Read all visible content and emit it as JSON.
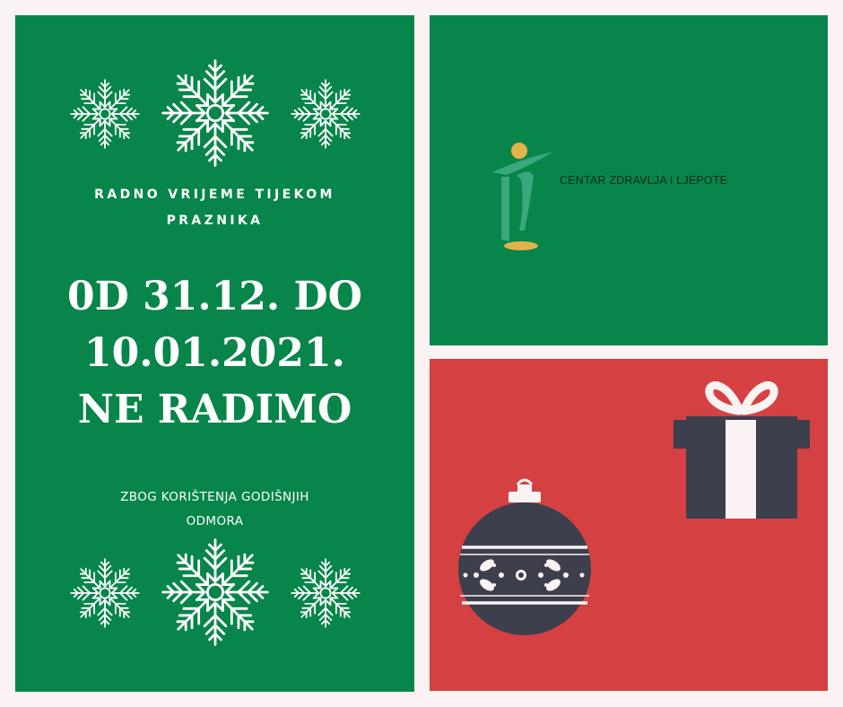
{
  "colors": {
    "green": "#07854a",
    "red": "#d54143",
    "background": "#fbf3f3",
    "logo_green": "#3aa77c",
    "logo_gold": "#e3b24a",
    "dark_slate": "#3d3f4c"
  },
  "icons": [
    "snowflake-icon",
    "logo-figure-icon",
    "gift-box-icon",
    "christmas-ornament-icon"
  ],
  "notice": {
    "subtitle_lines": [
      "RADNO VRIJEME TIJEKOM",
      "PRAZNIKA"
    ],
    "headline_lines": [
      "0D 31.12. DO",
      "10.01.2021.",
      "NE RADIMO"
    ],
    "note_lines": [
      "ZBOG KORIŠTENJA GODIŠNJIH",
      "ODMORA"
    ]
  },
  "logo": {
    "text": "CENTAR ZDRAVLJA I LJEPOTE"
  }
}
